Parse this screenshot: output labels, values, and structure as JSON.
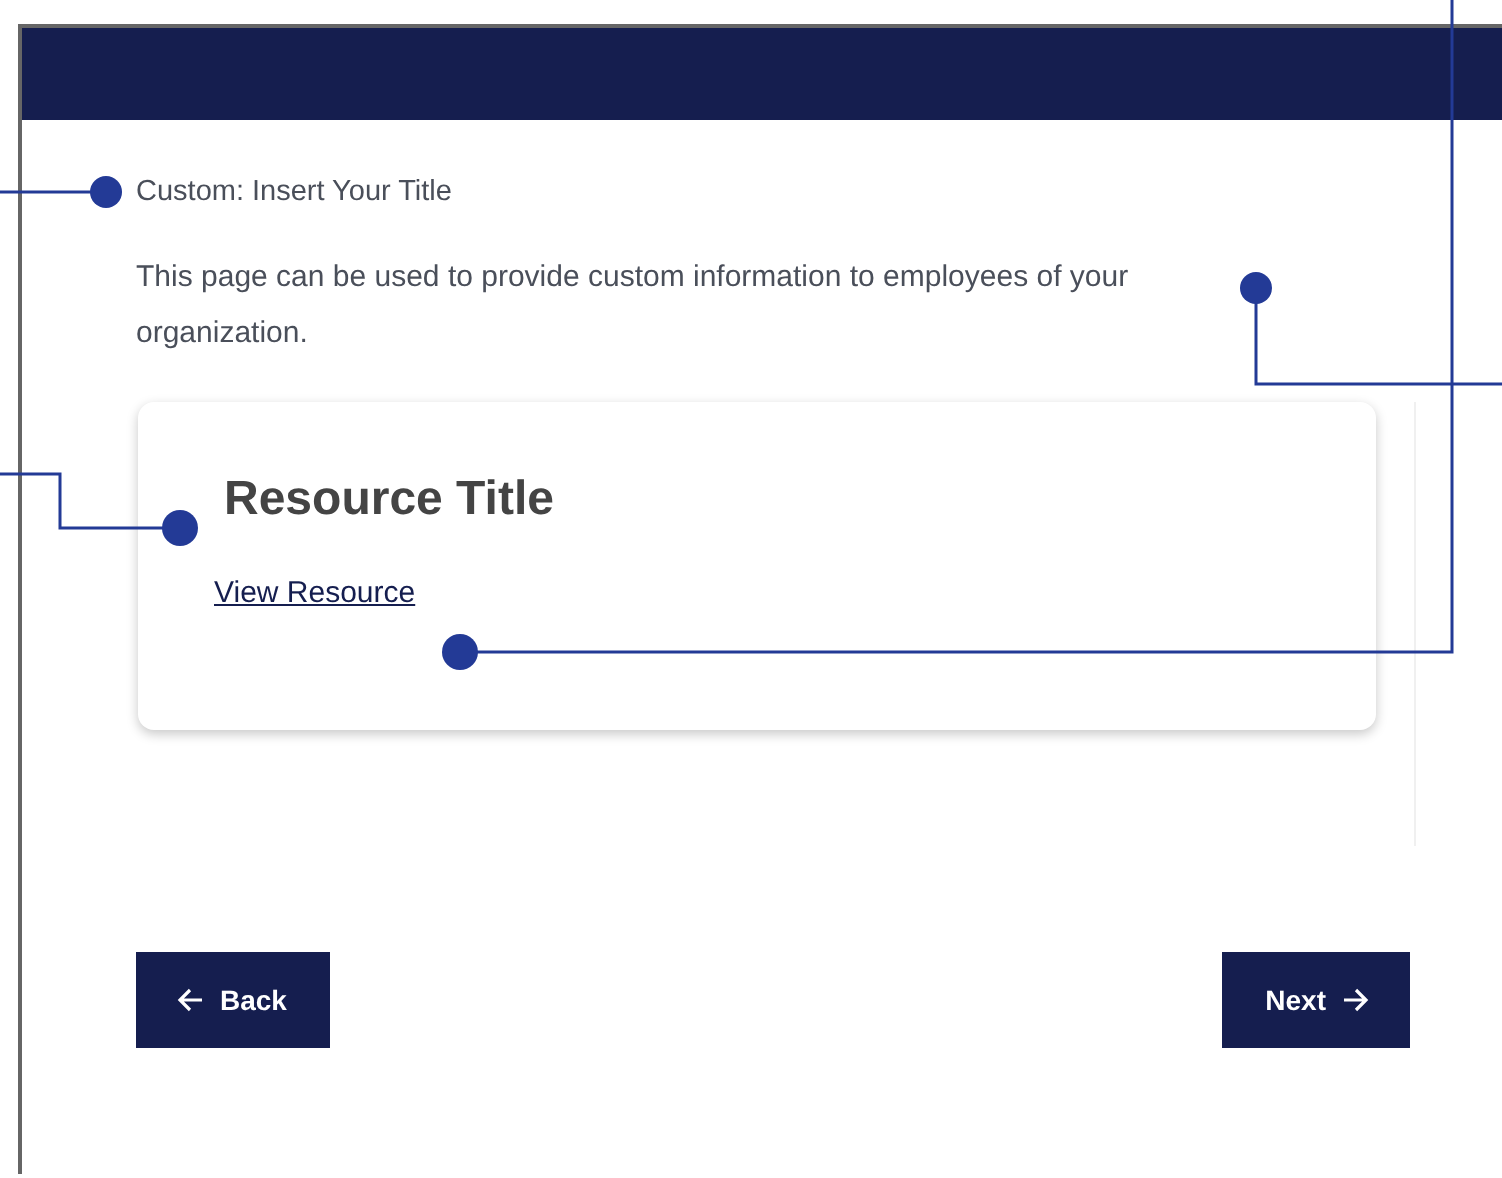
{
  "page": {
    "title": "Custom: Insert Your Title",
    "description": "This page can be used to provide custom information to employees of your organization."
  },
  "resource_card": {
    "title": "Resource Title",
    "link": "View Resource"
  },
  "buttons": [
    {
      "kind": "back",
      "label": "Back"
    },
    {
      "kind": "next",
      "label": "Next"
    }
  ]
}
